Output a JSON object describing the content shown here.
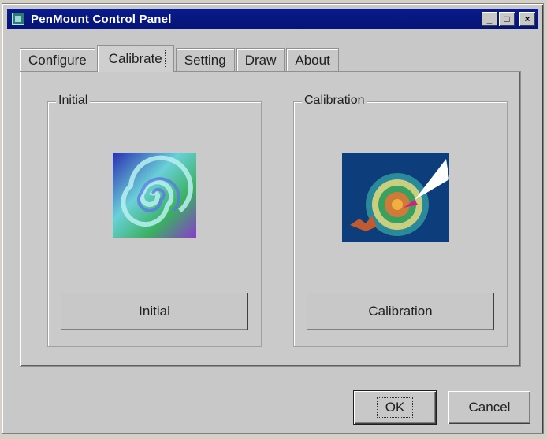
{
  "window": {
    "title": "PenMount Control Panel",
    "buttons": {
      "minimize": "_",
      "maximize": "□",
      "close": "×"
    }
  },
  "tabs": [
    {
      "label": "Configure",
      "active": false
    },
    {
      "label": "Calibrate",
      "active": true
    },
    {
      "label": "Setting",
      "active": false
    },
    {
      "label": "Draw",
      "active": false
    },
    {
      "label": "About",
      "active": false
    }
  ],
  "groups": {
    "initial": {
      "label": "Initial",
      "button": "Initial",
      "icon": "swirl-image"
    },
    "calibration": {
      "label": "Calibration",
      "button": "Calibration",
      "icon": "target-pen-image"
    }
  },
  "dialog": {
    "ok": "OK",
    "cancel": "Cancel"
  },
  "colors": {
    "titlebar": "#0a1b8a",
    "face": "#c8c8c8"
  }
}
